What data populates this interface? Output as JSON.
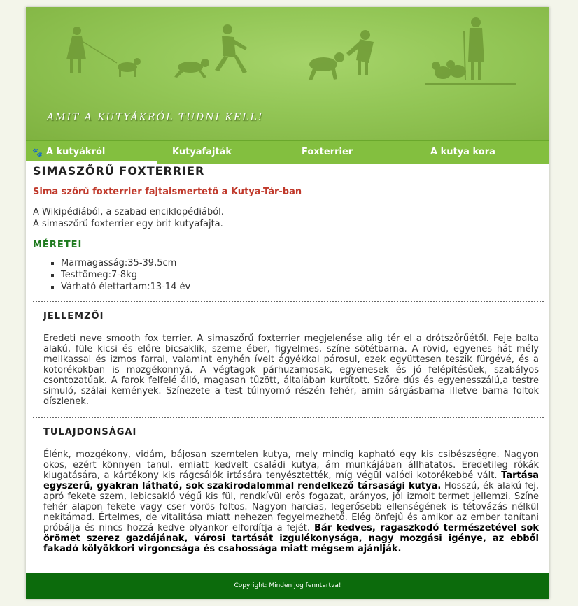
{
  "header": {
    "tagline": "Amit a kutyákról tudni kell!"
  },
  "nav": [
    {
      "label": "A kutyákról",
      "icon": "paw-icon",
      "active": true
    },
    {
      "label": "Kutyafajták",
      "active": false
    },
    {
      "label": "Foxterrier",
      "active": false
    },
    {
      "label": "A kutya kora",
      "active": false
    }
  ],
  "article": {
    "title": "SIMASZŐRŰ FOXTERRIER",
    "subtitle": "Sima szőrű foxterrier fajtaismertető a Kutya-Tár-ban",
    "intro_line1": "A Wikipédiából, a szabad enciklopédiából.",
    "intro_line2": "A simaszőrű foxterrier egy brit kutyafajta.",
    "sizes_heading": "MÉRETEI",
    "sizes": [
      "Marmagasság:35-39,5cm",
      "Testtömeg:7-8kg",
      "Várható élettartam:13-14 év"
    ],
    "traits_heading": "JELLEMZŐI",
    "traits_text": "Eredeti neve smooth fox terrier. A simaszőrű foxterrier megjelenése alig tér el a drótszőrűétől. Feje balta alakú, füle kicsi és előre bicsaklik, szeme éber, figyelmes, színe sötétbarna. A rövid, egyenes hát mély mellkassal és izmos farral, valamint enyhén ívelt ágyékkal párosul, ezek együttesen teszik fürgévé, és a kotorékokban is mozgékonnyá. A végtagok párhuzamosak, egyenesek és jó felépítésűek, szabályos csontozatúak. A farok felfelé álló, magasan tűzött, általában kurtított. Szőre dús és egyenesszálú,a testre simuló, szálai kemények. Színezete a test túlnyomó részén fehér, amin sárgásbarna illetve barna foltok díszlenek.",
    "props_heading": "TULAJDONSÁGAI",
    "props_text_1": "Élénk, mozgékony, vidám, bájosan szemtelen kutya, mely mindig kapható egy kis csibészségre. Nagyon okos, ezért könnyen tanul, emiatt kedvelt családi kutya, ám munkájában állhatatos. Eredetileg rókák kiugatására, a kártékony kis rágcsálók irtására tenyésztették, míg végül valódi kotorékebbé vált.",
    "props_bold_1": "Tartása egyszerű, gyakran látható, sok szakirodalommal rendelkező társasági kutya.",
    "props_text_2": "Hosszú, ék alakú fej, apró fekete szem, lebicsakló végű kis fül, rendkívül erős fogazat, arányos, jól izmolt termet jellemzi. Színe fehér alapon fekete vagy cser vörös foltos. Nagyon harcias, legerősebb ellenségének is tétovázás nélkül nekitámad. Értelmes, de vitalitása miatt nehezen fegyelmezhető. Elég önfejű és amikor az ember tanítani próbálja és nincs hozzá kedve olyankor elfordítja a fejét.",
    "props_bold_2": "Bár kedves, ragaszkodó természetével sok örömet szerez gazdájának, városi tartását izgulékonysága, nagy mozgási igénye, az ebből fakadó kölyökkori virgoncsága és csahossága miatt mégsem ajánlják."
  },
  "footer": {
    "text": "Copyright: Minden jog fenntartva!"
  },
  "colors": {
    "banner": "#93c656",
    "nav": "#83bf3f",
    "footer": "#0c6b0c",
    "subtitle": "#c0392b",
    "section_green": "#1e7a1e"
  }
}
